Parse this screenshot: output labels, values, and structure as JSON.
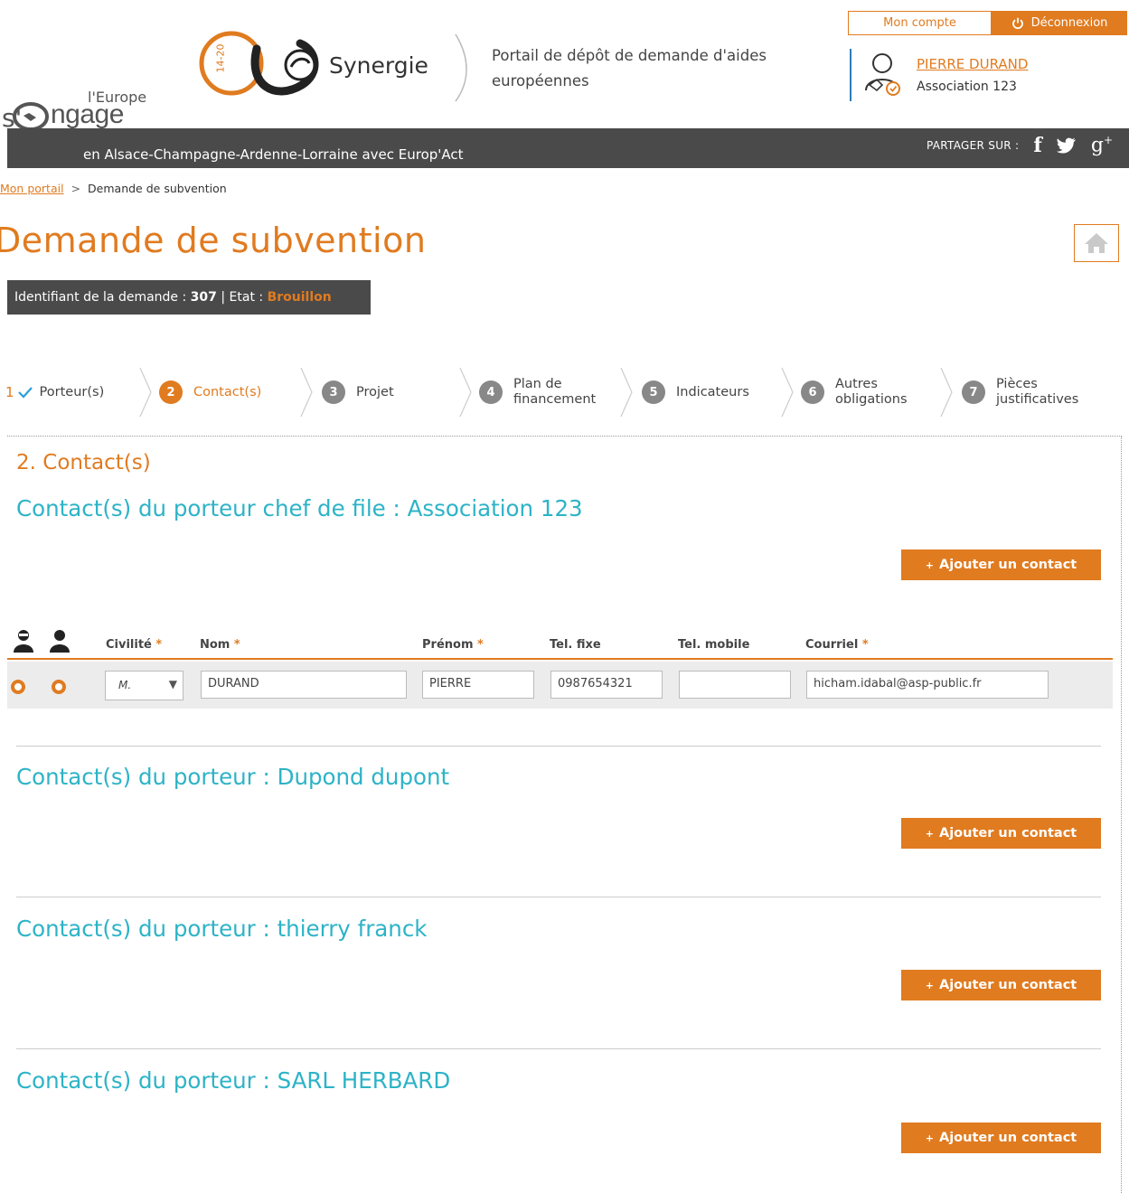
{
  "header": {
    "europe_logo_small": "l'Europe",
    "europe_logo_big": "s'engage",
    "synergie_logo_range": "14-20",
    "synergie_logo_name": "Synergie",
    "portal_title": "Portail de dépôt de demande d'aides européennes",
    "account_button": "Mon compte",
    "logout_button": "Déconnexion",
    "user_name": "PIERRE DURAND",
    "user_org": "Association 123",
    "region_text": "en Alsace-Champagne-Ardenne-Lorraine avec Europ'Act",
    "share_label": "PARTAGER SUR :",
    "social_icons": [
      "facebook-icon",
      "twitter-icon",
      "googleplus-icon"
    ]
  },
  "breadcrumb": {
    "home_link": "Mon portail",
    "separator": ">",
    "current": "Demande de subvention"
  },
  "page": {
    "title": "Demande de subvention",
    "id_label": "Identifiant de la demande :",
    "id_value": "307",
    "state_label": "| Etat :",
    "state_value": "Brouillon"
  },
  "steps": [
    {
      "num": "1",
      "label": "Porteur(s)",
      "done": true
    },
    {
      "num": "2",
      "label": "Contact(s)",
      "active": true
    },
    {
      "num": "3",
      "label": "Projet"
    },
    {
      "num": "4",
      "label": "Plan de financement"
    },
    {
      "num": "5",
      "label": "Indicateurs"
    },
    {
      "num": "6",
      "label": "Autres obligations"
    },
    {
      "num": "7",
      "label": "Pièces justificatives"
    }
  ],
  "section": {
    "title": "2. Contact(s)",
    "add_button": "Ajouter un contact",
    "groups": [
      {
        "title": "Contact(s) du porteur chef de file : Association 123"
      },
      {
        "title": "Contact(s) du porteur : Dupond dupont"
      },
      {
        "title": "Contact(s) du porteur : thierry franck"
      },
      {
        "title": "Contact(s) du porteur : SARL HERBARD"
      }
    ]
  },
  "table": {
    "columns": [
      "Civilité",
      "Nom",
      "Prénom",
      "Tel. fixe",
      "Tel. mobile",
      "Courriel"
    ],
    "required_mark": "*",
    "rows": [
      {
        "civilite": "M.",
        "nom": "DURAND",
        "prenom": "PIERRE",
        "tel_fixe": "0987654321",
        "tel_mobile": "",
        "courriel": "hicham.idabal@asp-public.fr"
      }
    ]
  },
  "colors": {
    "accent": "#e07b20",
    "heading_teal": "#2db3c7",
    "dark_bar": "#4a4a4a"
  }
}
